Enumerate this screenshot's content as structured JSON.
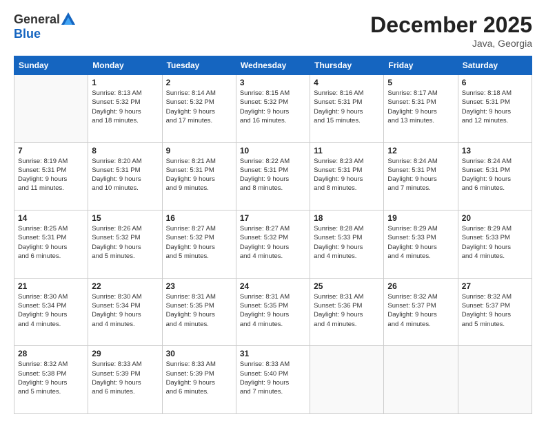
{
  "logo": {
    "general": "General",
    "blue": "Blue"
  },
  "title": "December 2025",
  "subtitle": "Java, Georgia",
  "weekdays": [
    "Sunday",
    "Monday",
    "Tuesday",
    "Wednesday",
    "Thursday",
    "Friday",
    "Saturday"
  ],
  "weeks": [
    [
      {
        "day": "",
        "info": ""
      },
      {
        "day": "1",
        "info": "Sunrise: 8:13 AM\nSunset: 5:32 PM\nDaylight: 9 hours\nand 18 minutes."
      },
      {
        "day": "2",
        "info": "Sunrise: 8:14 AM\nSunset: 5:32 PM\nDaylight: 9 hours\nand 17 minutes."
      },
      {
        "day": "3",
        "info": "Sunrise: 8:15 AM\nSunset: 5:32 PM\nDaylight: 9 hours\nand 16 minutes."
      },
      {
        "day": "4",
        "info": "Sunrise: 8:16 AM\nSunset: 5:31 PM\nDaylight: 9 hours\nand 15 minutes."
      },
      {
        "day": "5",
        "info": "Sunrise: 8:17 AM\nSunset: 5:31 PM\nDaylight: 9 hours\nand 13 minutes."
      },
      {
        "day": "6",
        "info": "Sunrise: 8:18 AM\nSunset: 5:31 PM\nDaylight: 9 hours\nand 12 minutes."
      }
    ],
    [
      {
        "day": "7",
        "info": "Sunrise: 8:19 AM\nSunset: 5:31 PM\nDaylight: 9 hours\nand 11 minutes."
      },
      {
        "day": "8",
        "info": "Sunrise: 8:20 AM\nSunset: 5:31 PM\nDaylight: 9 hours\nand 10 minutes."
      },
      {
        "day": "9",
        "info": "Sunrise: 8:21 AM\nSunset: 5:31 PM\nDaylight: 9 hours\nand 9 minutes."
      },
      {
        "day": "10",
        "info": "Sunrise: 8:22 AM\nSunset: 5:31 PM\nDaylight: 9 hours\nand 8 minutes."
      },
      {
        "day": "11",
        "info": "Sunrise: 8:23 AM\nSunset: 5:31 PM\nDaylight: 9 hours\nand 8 minutes."
      },
      {
        "day": "12",
        "info": "Sunrise: 8:24 AM\nSunset: 5:31 PM\nDaylight: 9 hours\nand 7 minutes."
      },
      {
        "day": "13",
        "info": "Sunrise: 8:24 AM\nSunset: 5:31 PM\nDaylight: 9 hours\nand 6 minutes."
      }
    ],
    [
      {
        "day": "14",
        "info": "Sunrise: 8:25 AM\nSunset: 5:31 PM\nDaylight: 9 hours\nand 6 minutes."
      },
      {
        "day": "15",
        "info": "Sunrise: 8:26 AM\nSunset: 5:32 PM\nDaylight: 9 hours\nand 5 minutes."
      },
      {
        "day": "16",
        "info": "Sunrise: 8:27 AM\nSunset: 5:32 PM\nDaylight: 9 hours\nand 5 minutes."
      },
      {
        "day": "17",
        "info": "Sunrise: 8:27 AM\nSunset: 5:32 PM\nDaylight: 9 hours\nand 4 minutes."
      },
      {
        "day": "18",
        "info": "Sunrise: 8:28 AM\nSunset: 5:33 PM\nDaylight: 9 hours\nand 4 minutes."
      },
      {
        "day": "19",
        "info": "Sunrise: 8:29 AM\nSunset: 5:33 PM\nDaylight: 9 hours\nand 4 minutes."
      },
      {
        "day": "20",
        "info": "Sunrise: 8:29 AM\nSunset: 5:33 PM\nDaylight: 9 hours\nand 4 minutes."
      }
    ],
    [
      {
        "day": "21",
        "info": "Sunrise: 8:30 AM\nSunset: 5:34 PM\nDaylight: 9 hours\nand 4 minutes."
      },
      {
        "day": "22",
        "info": "Sunrise: 8:30 AM\nSunset: 5:34 PM\nDaylight: 9 hours\nand 4 minutes."
      },
      {
        "day": "23",
        "info": "Sunrise: 8:31 AM\nSunset: 5:35 PM\nDaylight: 9 hours\nand 4 minutes."
      },
      {
        "day": "24",
        "info": "Sunrise: 8:31 AM\nSunset: 5:35 PM\nDaylight: 9 hours\nand 4 minutes."
      },
      {
        "day": "25",
        "info": "Sunrise: 8:31 AM\nSunset: 5:36 PM\nDaylight: 9 hours\nand 4 minutes."
      },
      {
        "day": "26",
        "info": "Sunrise: 8:32 AM\nSunset: 5:37 PM\nDaylight: 9 hours\nand 4 minutes."
      },
      {
        "day": "27",
        "info": "Sunrise: 8:32 AM\nSunset: 5:37 PM\nDaylight: 9 hours\nand 5 minutes."
      }
    ],
    [
      {
        "day": "28",
        "info": "Sunrise: 8:32 AM\nSunset: 5:38 PM\nDaylight: 9 hours\nand 5 minutes."
      },
      {
        "day": "29",
        "info": "Sunrise: 8:33 AM\nSunset: 5:39 PM\nDaylight: 9 hours\nand 6 minutes."
      },
      {
        "day": "30",
        "info": "Sunrise: 8:33 AM\nSunset: 5:39 PM\nDaylight: 9 hours\nand 6 minutes."
      },
      {
        "day": "31",
        "info": "Sunrise: 8:33 AM\nSunset: 5:40 PM\nDaylight: 9 hours\nand 7 minutes."
      },
      {
        "day": "",
        "info": ""
      },
      {
        "day": "",
        "info": ""
      },
      {
        "day": "",
        "info": ""
      }
    ]
  ]
}
